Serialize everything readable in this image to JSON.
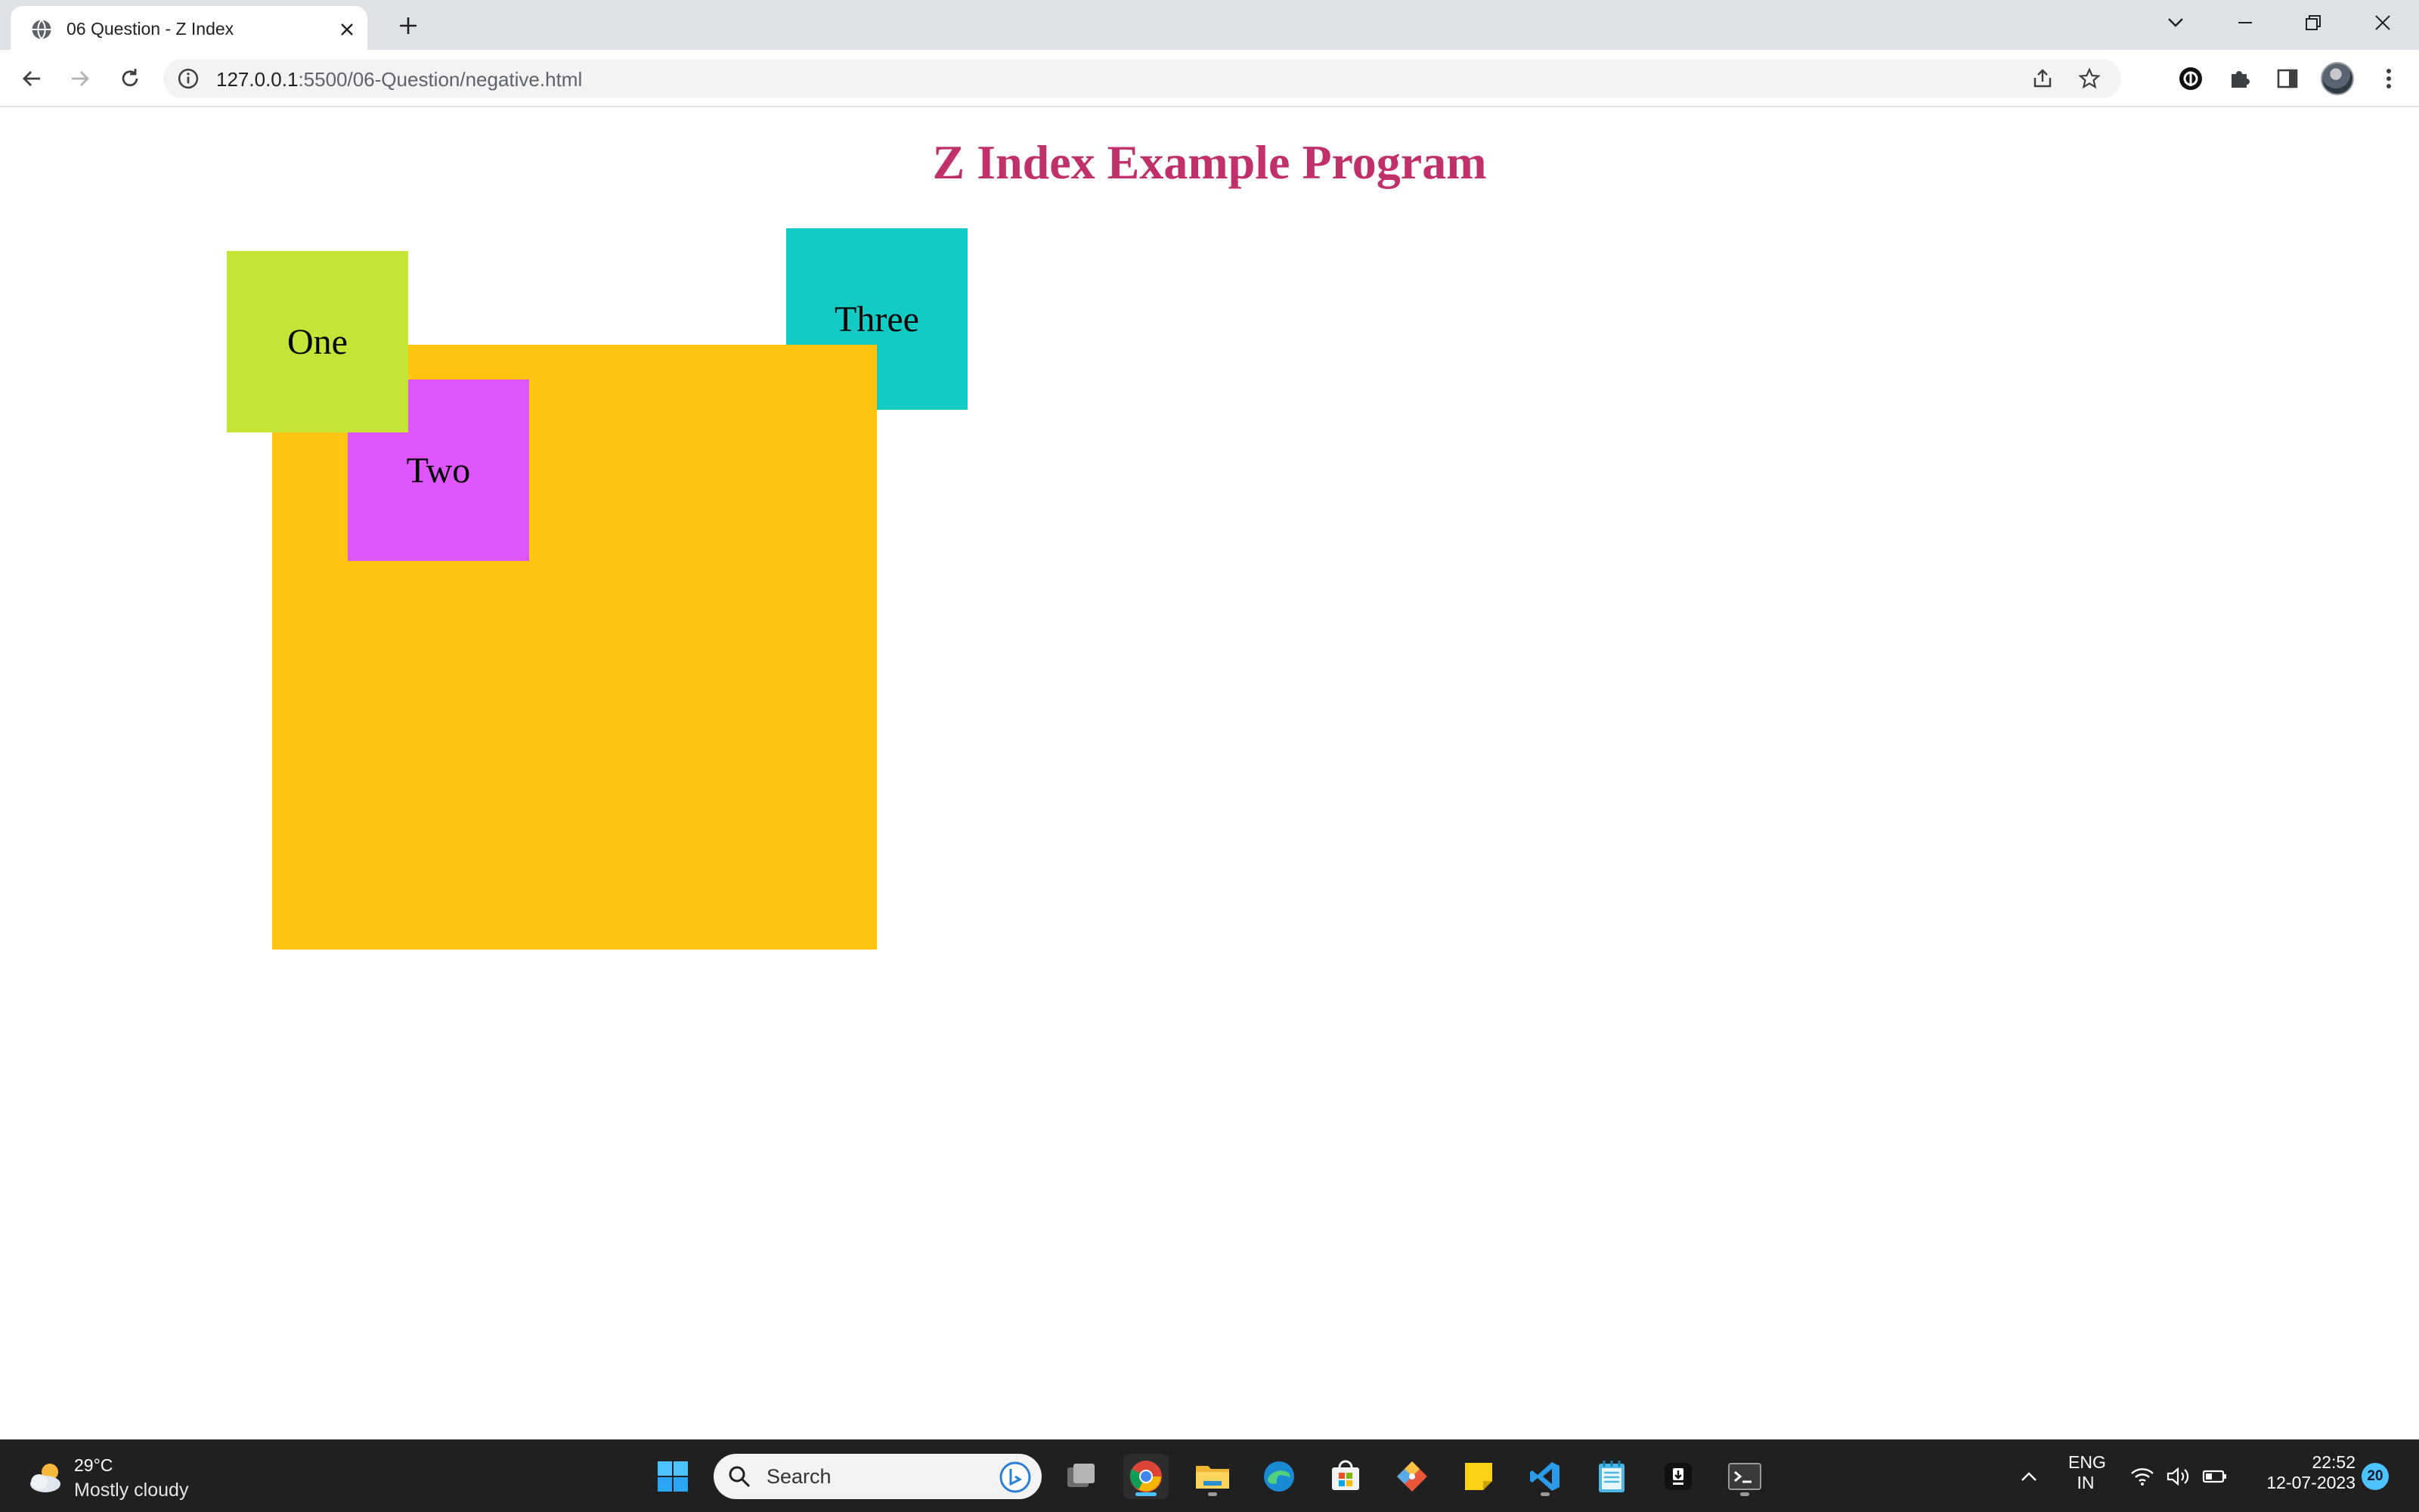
{
  "browser": {
    "tab_title": "06 Question - Z Index",
    "url_host": "127.0.0.1",
    "url_path": ":5500/06-Question/negative.html"
  },
  "page": {
    "title": "Z Index Example Program",
    "boxes": {
      "one": "One",
      "two": "Two",
      "three": "Three"
    },
    "colors": {
      "title": "#c0306a",
      "big_box": "#ffc312",
      "one": "#c4e538",
      "two": "#e056fd",
      "three": "#12cbc4"
    }
  },
  "taskbar": {
    "weather_temp": "29°C",
    "weather_desc": "Mostly cloudy",
    "search_placeholder": "Search",
    "language_line1": "ENG",
    "language_line2": "IN",
    "time": "22:52",
    "date": "12-07-2023",
    "notification_count": "20",
    "apps": [
      "start-icon",
      "search",
      "task-view-icon",
      "chrome-icon",
      "file-explorer-icon",
      "edge-icon",
      "microsoft-store-icon",
      "git-icon",
      "sticky-notes-icon",
      "vscode-icon",
      "notepad-icon",
      "app-icon",
      "terminal-icon"
    ]
  }
}
